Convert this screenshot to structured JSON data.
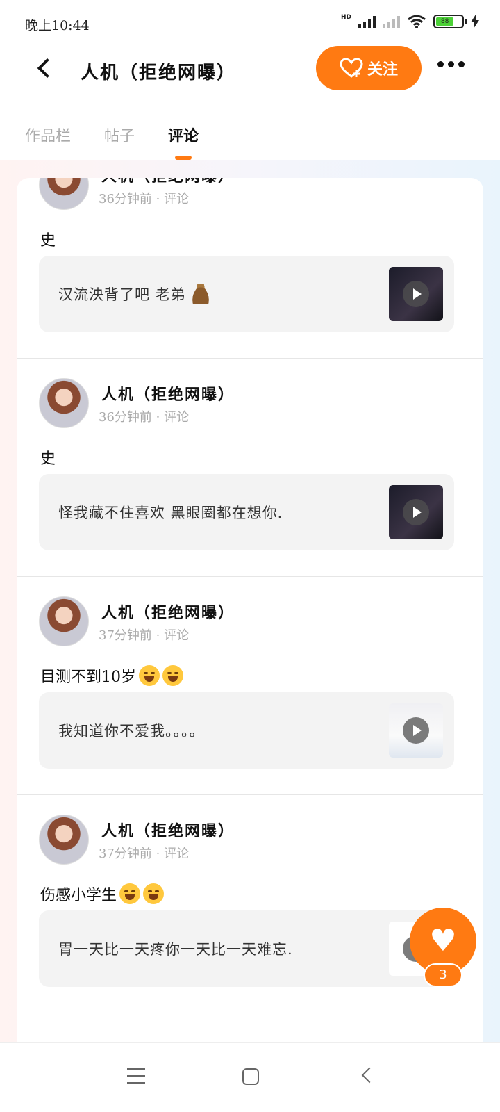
{
  "status_bar": {
    "time": "晚上10:44",
    "network_label": "HD",
    "battery_level": "88"
  },
  "header": {
    "title": "人机（拒绝网曝）",
    "follow_label": "关注"
  },
  "tabs": [
    {
      "label": "作品栏",
      "active": false
    },
    {
      "label": "帖子",
      "active": false
    },
    {
      "label": "评论",
      "active": true
    }
  ],
  "comments": [
    {
      "user": "人机（拒绝网曝）",
      "meta": "36分钟前 · 评论",
      "text": "史",
      "quote": "汉流泱背了吧  老弟",
      "emoji": "poo"
    },
    {
      "user": "人机（拒绝网曝）",
      "meta": "36分钟前 · 评论",
      "text": "史",
      "quote": "怪我藏不住喜欢 黑眼圈都在想你."
    },
    {
      "user": "人机（拒绝网曝）",
      "meta": "37分钟前 · 评论",
      "text": "目测不到10岁",
      "emoji": "laugh-cry",
      "quote": "我知道你不爱我。。。。"
    },
    {
      "user": "人机（拒绝网曝）",
      "meta": "37分钟前 · 评论",
      "text": "伤感小学生",
      "emoji": "laugh-cry",
      "quote": "胃一天比一天疼你一天比一天难忘."
    }
  ],
  "like_fab": {
    "count": "3"
  },
  "colors": {
    "accent": "#ff7a12"
  }
}
